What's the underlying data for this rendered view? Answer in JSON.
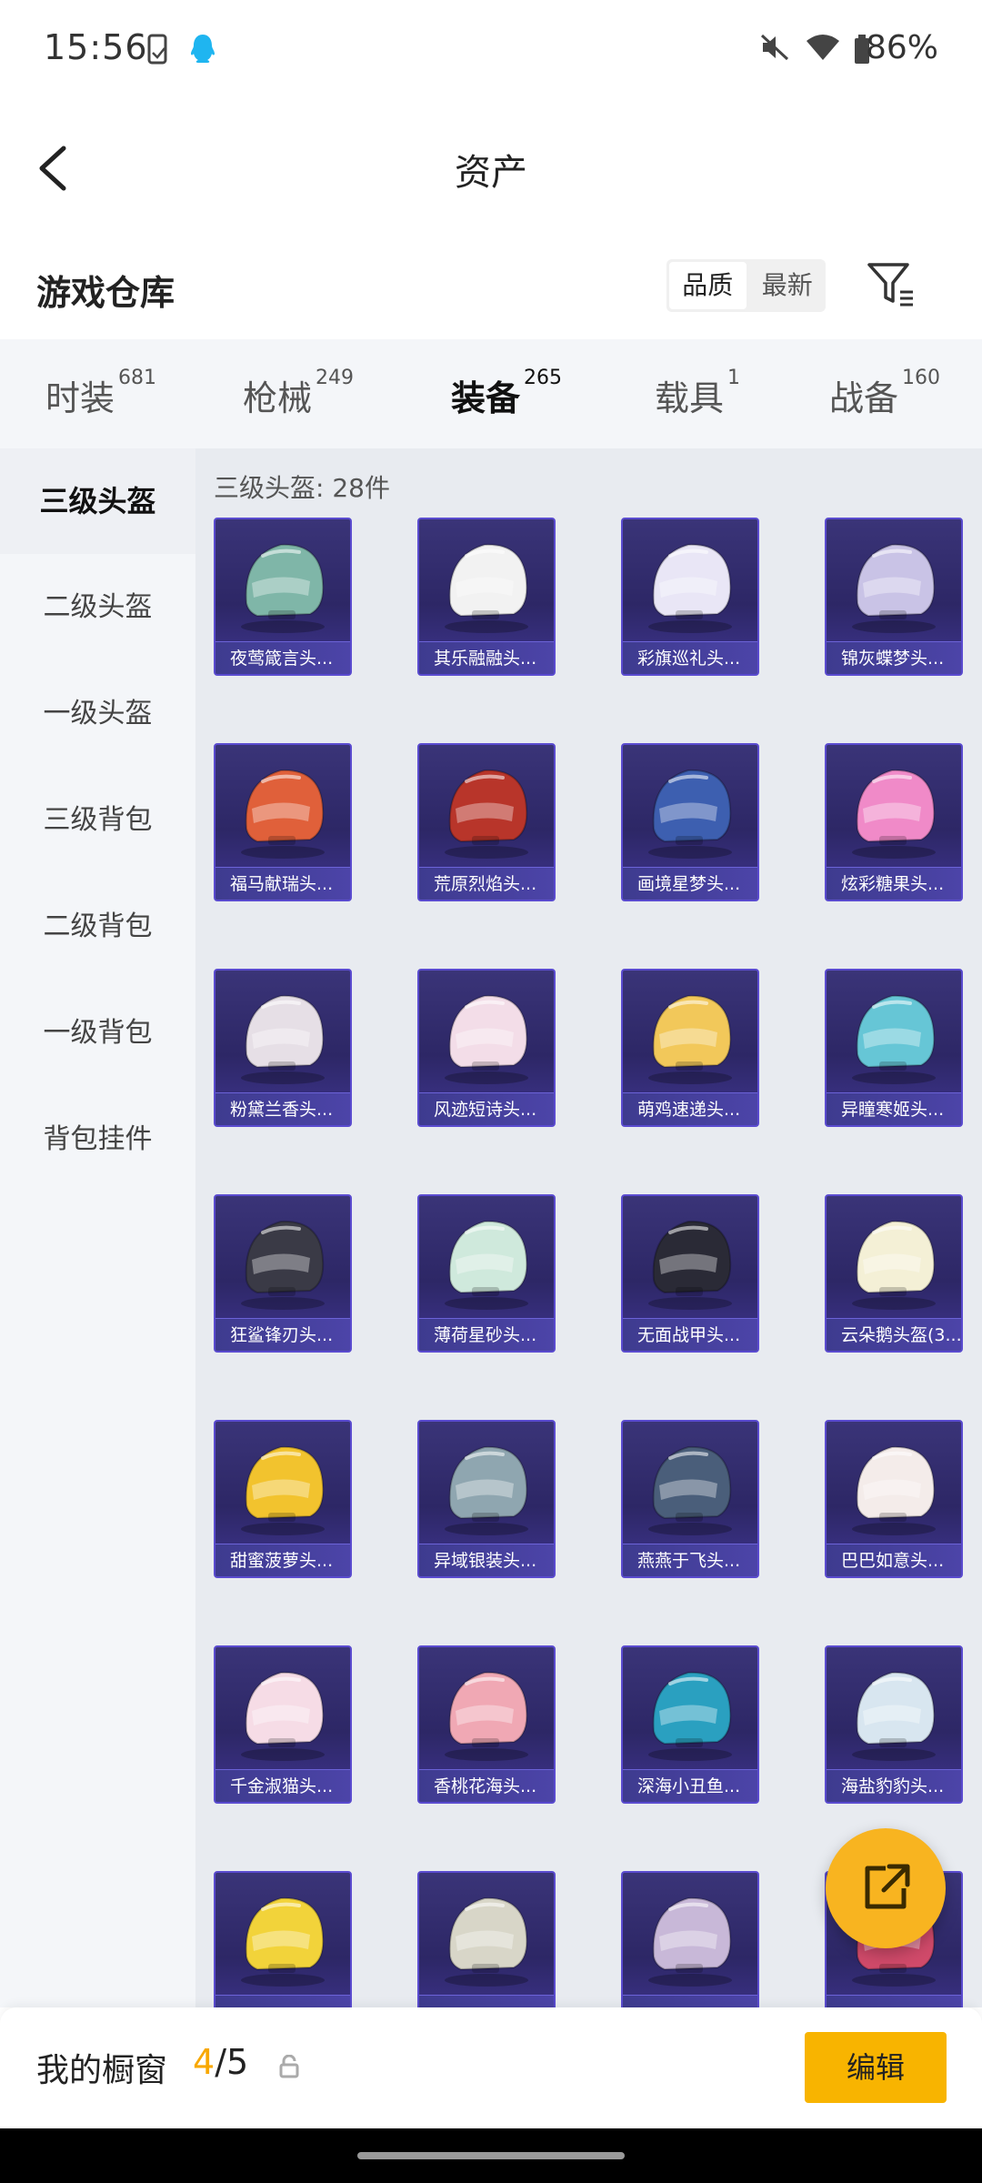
{
  "status_bar": {
    "time": "15:56",
    "battery": "86%"
  },
  "header": {
    "title": "资产"
  },
  "warehouse": {
    "title": "游戏仓库",
    "sort_options": [
      "品质",
      "最新"
    ],
    "active_sort": "品质"
  },
  "tabs": [
    {
      "label": "时装",
      "count": "681"
    },
    {
      "label": "枪械",
      "count": "249"
    },
    {
      "label": "装备",
      "count": "265",
      "active": true
    },
    {
      "label": "载具",
      "count": "1"
    },
    {
      "label": "战备",
      "count": "160"
    }
  ],
  "sidebar": {
    "items": [
      "三级头盔",
      "二级头盔",
      "一级头盔",
      "三级背包",
      "二级背包",
      "一级背包",
      "背包挂件"
    ],
    "active": "三级头盔"
  },
  "content": {
    "title": "三级头盔: 28件",
    "items": [
      {
        "name": "夜莺箴言头...",
        "color": "#7fb6a8"
      },
      {
        "name": "其乐融融头...",
        "color": "#f2f2f2"
      },
      {
        "name": "彩旗巡礼头...",
        "color": "#e9e6f6"
      },
      {
        "name": "锦灰蝶梦头...",
        "color": "#c9c3e6"
      },
      {
        "name": "福马献瑞头...",
        "color": "#e0603a"
      },
      {
        "name": "荒原烈焰头...",
        "color": "#b8352a"
      },
      {
        "name": "画境星梦头...",
        "color": "#3d5fb0"
      },
      {
        "name": "炫彩糖果头...",
        "color": "#f08ac8"
      },
      {
        "name": "粉黛兰香头...",
        "color": "#e6dfe6"
      },
      {
        "name": "风迹短诗头...",
        "color": "#f3dde8"
      },
      {
        "name": "萌鸡速递头...",
        "color": "#f2c85a"
      },
      {
        "name": "异瞳寒姬头...",
        "color": "#66c6d6"
      },
      {
        "name": "狂鲨锋刃头...",
        "color": "#3a3a46"
      },
      {
        "name": "薄荷星砂头...",
        "color": "#cfe9dc"
      },
      {
        "name": "无面战甲头...",
        "color": "#2a2a36"
      },
      {
        "name": "云朵鹅头盔(3...",
        "color": "#f4f0d6"
      },
      {
        "name": "甜蜜菠萝头...",
        "color": "#f2c32e"
      },
      {
        "name": "异域银装头...",
        "color": "#8fa6b0"
      },
      {
        "name": "燕燕于飞头...",
        "color": "#4a5e7a"
      },
      {
        "name": "巴巴如意头...",
        "color": "#f4ecea"
      },
      {
        "name": "千金淑猫头...",
        "color": "#f6dce6"
      },
      {
        "name": "香桃花海头...",
        "color": "#f0a8b4"
      },
      {
        "name": "深海小丑鱼...",
        "color": "#2aa0c0"
      },
      {
        "name": "海盐豹豹头...",
        "color": "#d8e6f0"
      },
      {
        "name": "",
        "color": "#f2d33a"
      },
      {
        "name": "",
        "color": "#d8d6c8"
      },
      {
        "name": "",
        "color": "#c8b8d8"
      },
      {
        "name": "",
        "color": "#d04a6a"
      }
    ]
  },
  "showcase": {
    "label": "我的橱窗",
    "current": "4",
    "total": "/5",
    "edit_label": "编辑"
  },
  "colors": {
    "accent": "#f8b400",
    "card_border": "#5a4bcf",
    "card_bg": "#2d2766"
  }
}
